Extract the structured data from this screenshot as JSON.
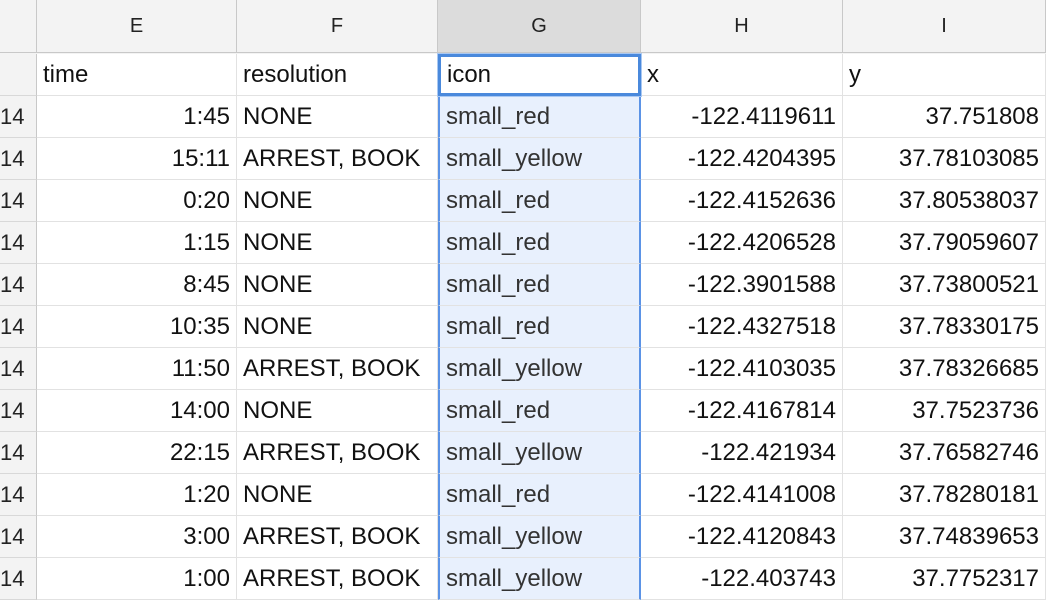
{
  "columns": [
    {
      "letter": "E",
      "selected": false
    },
    {
      "letter": "F",
      "selected": false
    },
    {
      "letter": "G",
      "selected": true
    },
    {
      "letter": "H",
      "selected": false
    },
    {
      "letter": "I",
      "selected": false
    }
  ],
  "header_row": {
    "rownum": "",
    "time": "time",
    "resolution": "resolution",
    "icon": "icon",
    "x": "x",
    "y": "y"
  },
  "rows": [
    {
      "rownum": "14",
      "time": "1:45",
      "resolution": "NONE",
      "icon": "small_red",
      "x": "-122.4119611",
      "y": "37.751808"
    },
    {
      "rownum": "14",
      "time": "15:11",
      "resolution": "ARREST, BOOK",
      "icon": "small_yellow",
      "x": "-122.4204395",
      "y": "37.78103085"
    },
    {
      "rownum": "14",
      "time": "0:20",
      "resolution": "NONE",
      "icon": "small_red",
      "x": "-122.4152636",
      "y": "37.80538037"
    },
    {
      "rownum": "14",
      "time": "1:15",
      "resolution": "NONE",
      "icon": "small_red",
      "x": "-122.4206528",
      "y": "37.79059607"
    },
    {
      "rownum": "14",
      "time": "8:45",
      "resolution": "NONE",
      "icon": "small_red",
      "x": "-122.3901588",
      "y": "37.73800521"
    },
    {
      "rownum": "14",
      "time": "10:35",
      "resolution": "NONE",
      "icon": "small_red",
      "x": "-122.4327518",
      "y": "37.78330175"
    },
    {
      "rownum": "14",
      "time": "11:50",
      "resolution": "ARREST, BOOK",
      "icon": "small_yellow",
      "x": "-122.4103035",
      "y": "37.78326685"
    },
    {
      "rownum": "14",
      "time": "14:00",
      "resolution": "NONE",
      "icon": "small_red",
      "x": "-122.4167814",
      "y": "37.7523736"
    },
    {
      "rownum": "14",
      "time": "22:15",
      "resolution": "ARREST, BOOK",
      "icon": "small_yellow",
      "x": "-122.421934",
      "y": "37.76582746"
    },
    {
      "rownum": "14",
      "time": "1:20",
      "resolution": "NONE",
      "icon": "small_red",
      "x": "-122.4141008",
      "y": "37.78280181"
    },
    {
      "rownum": "14",
      "time": "3:00",
      "resolution": "ARREST, BOOK",
      "icon": "small_yellow",
      "x": "-122.4120843",
      "y": "37.74839653"
    },
    {
      "rownum": "14",
      "time": "1:00",
      "resolution": "ARREST, BOOK",
      "icon": "small_yellow",
      "x": "-122.403743",
      "y": "37.7752317"
    }
  ]
}
